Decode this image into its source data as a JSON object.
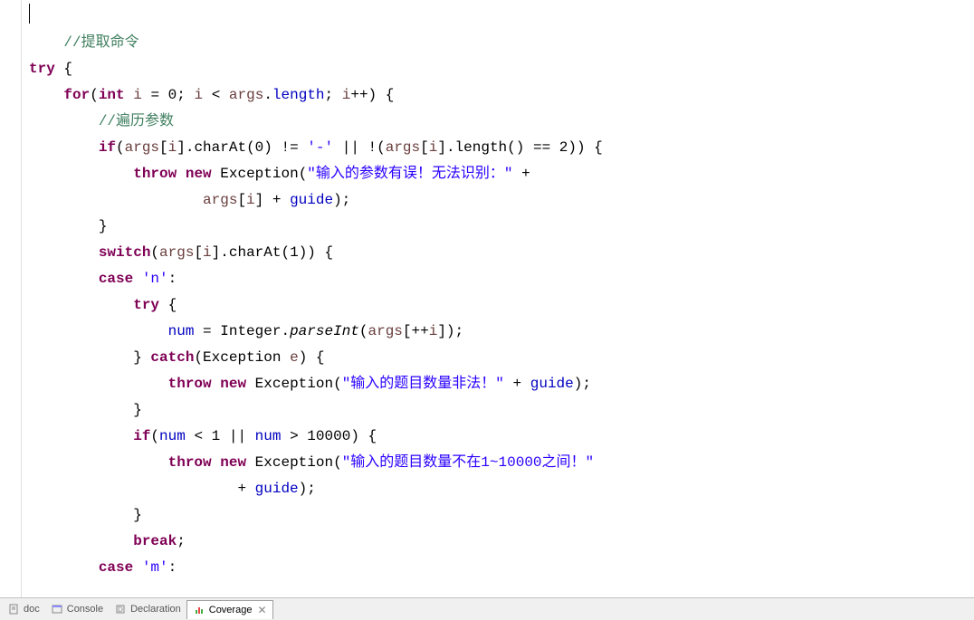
{
  "code": {
    "line1_comment": "//提取命令",
    "line2_try": "try",
    "line3_for": "for",
    "line3_int": "int",
    "line3_i": "i",
    "line3_zero": "0",
    "line3_i2": "i",
    "line3_lt": "<",
    "line3_args": "args",
    "line3_length": "length",
    "line3_i3": "i",
    "line4_comment": "//遍历参数",
    "line5_if": "if",
    "line5_args": "args",
    "line5_i": "i",
    "line5_charAt": "charAt",
    "line5_zero": "0",
    "line5_ne": "!=",
    "line5_dash": "'-'",
    "line5_or": "||",
    "line5_not": "!",
    "line5_args2": "args",
    "line5_i2": "i",
    "line5_length": "length",
    "line5_eq": "==",
    "line5_two": "2",
    "line6_throw": "throw",
    "line6_new": "new",
    "line6_Exception": "Exception",
    "line6_str": "\"输入的参数有误！无法识别：\"",
    "line6_plus": "+",
    "line7_args": "args",
    "line7_i": "i",
    "line7_plus": "+",
    "line7_guide": "guide",
    "line9_switch": "switch",
    "line9_args": "args",
    "line9_i": "i",
    "line9_charAt": "charAt",
    "line9_one": "1",
    "line10_case": "case",
    "line10_n": "'n'",
    "line11_try": "try",
    "line12_num": "num",
    "line12_Integer": "Integer",
    "line12_parseInt": "parseInt",
    "line12_args": "args",
    "line12_i": "i",
    "line13_catch": "catch",
    "line13_Exception": "Exception",
    "line13_e": "e",
    "line14_throw": "throw",
    "line14_new": "new",
    "line14_Exception": "Exception",
    "line14_str": "\"输入的题目数量非法！\"",
    "line14_plus": "+",
    "line14_guide": "guide",
    "line16_if": "if",
    "line16_num": "num",
    "line16_lt": "<",
    "line16_one": "1",
    "line16_or": "||",
    "line16_num2": "num",
    "line16_gt": ">",
    "line16_tenk": "10000",
    "line17_throw": "throw",
    "line17_new": "new",
    "line17_Exception": "Exception",
    "line17_str": "\"输入的题目数量不在1~10000之间！\"",
    "line18_plus": "+",
    "line18_guide": "guide",
    "line20_break": "break",
    "line21_case": "case",
    "line21_m": "'m'"
  },
  "tabs": {
    "tab1": "doc",
    "tab2": "Console",
    "tab3": "Declaration",
    "tab4": "Coverage"
  }
}
